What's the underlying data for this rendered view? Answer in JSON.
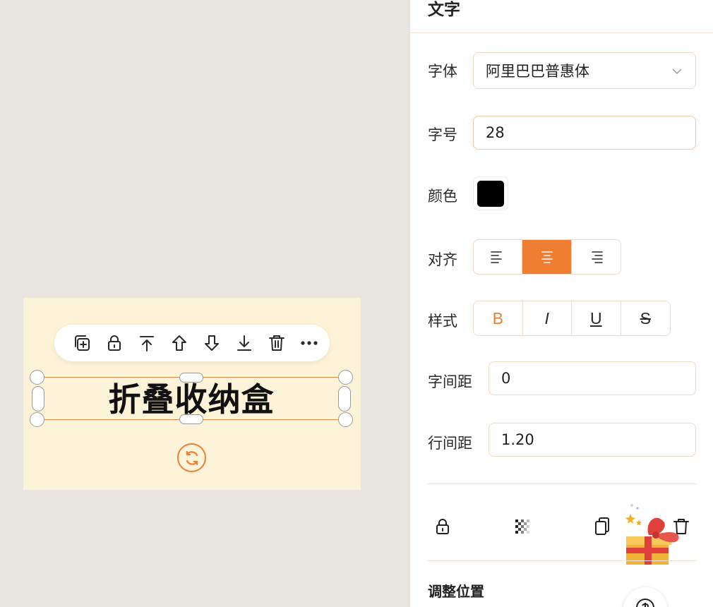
{
  "canvas": {
    "text_content": "折叠收纳盒",
    "toolbar_icons": [
      "duplicate-icon",
      "lock-icon",
      "bring-to-front-icon",
      "move-up-icon",
      "move-down-icon",
      "send-to-back-icon",
      "delete-icon",
      "more-icon"
    ]
  },
  "panel": {
    "title": "文字",
    "font": {
      "label": "字体",
      "value": "阿里巴巴普惠体"
    },
    "size": {
      "label": "字号",
      "value": "28"
    },
    "color": {
      "label": "颜色",
      "value": "#000000"
    },
    "align": {
      "label": "对齐",
      "options": [
        "left",
        "center",
        "right"
      ],
      "selected": "center"
    },
    "style": {
      "label": "样式",
      "options": [
        "B",
        "I",
        "U",
        "S"
      ],
      "active": "B"
    },
    "letter_spacing": {
      "label": "字间距",
      "value": "0"
    },
    "line_height": {
      "label": "行间距",
      "value": "1.20"
    },
    "actions": [
      "lock-icon",
      "opacity-icon",
      "copy-icon",
      "delete-icon"
    ],
    "section_title": "调整位置"
  },
  "colors": {
    "accent": "#ef7d32",
    "artboard": "#fdf3d8",
    "canvas_bg": "#e9e6e1"
  }
}
